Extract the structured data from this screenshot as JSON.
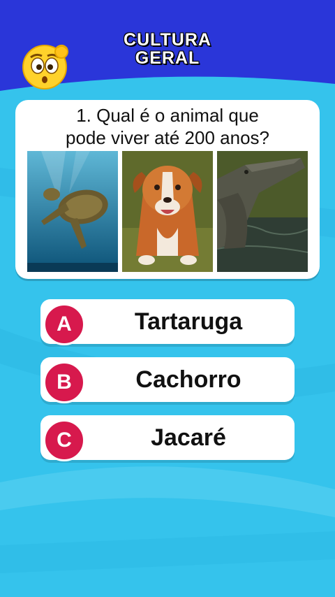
{
  "header": {
    "title_line1": "CULTURA",
    "title_line2": "GERAL",
    "emoji_icon": "thinking-face-icon"
  },
  "question": {
    "text_line1": "1. Qual é o animal que",
    "text_line2": "pode viver até 200 anos?",
    "images": [
      "sea-turtle-photo",
      "dog-photo",
      "alligator-photo"
    ]
  },
  "answers": [
    {
      "letter": "A",
      "label": "Tartaruga"
    },
    {
      "letter": "B",
      "label": "Cachorro"
    },
    {
      "letter": "C",
      "label": "Jacaré"
    }
  ],
  "colors": {
    "top_blue": "#2a36d9",
    "sky": "#35c3ec",
    "badge": "#d7194d"
  }
}
